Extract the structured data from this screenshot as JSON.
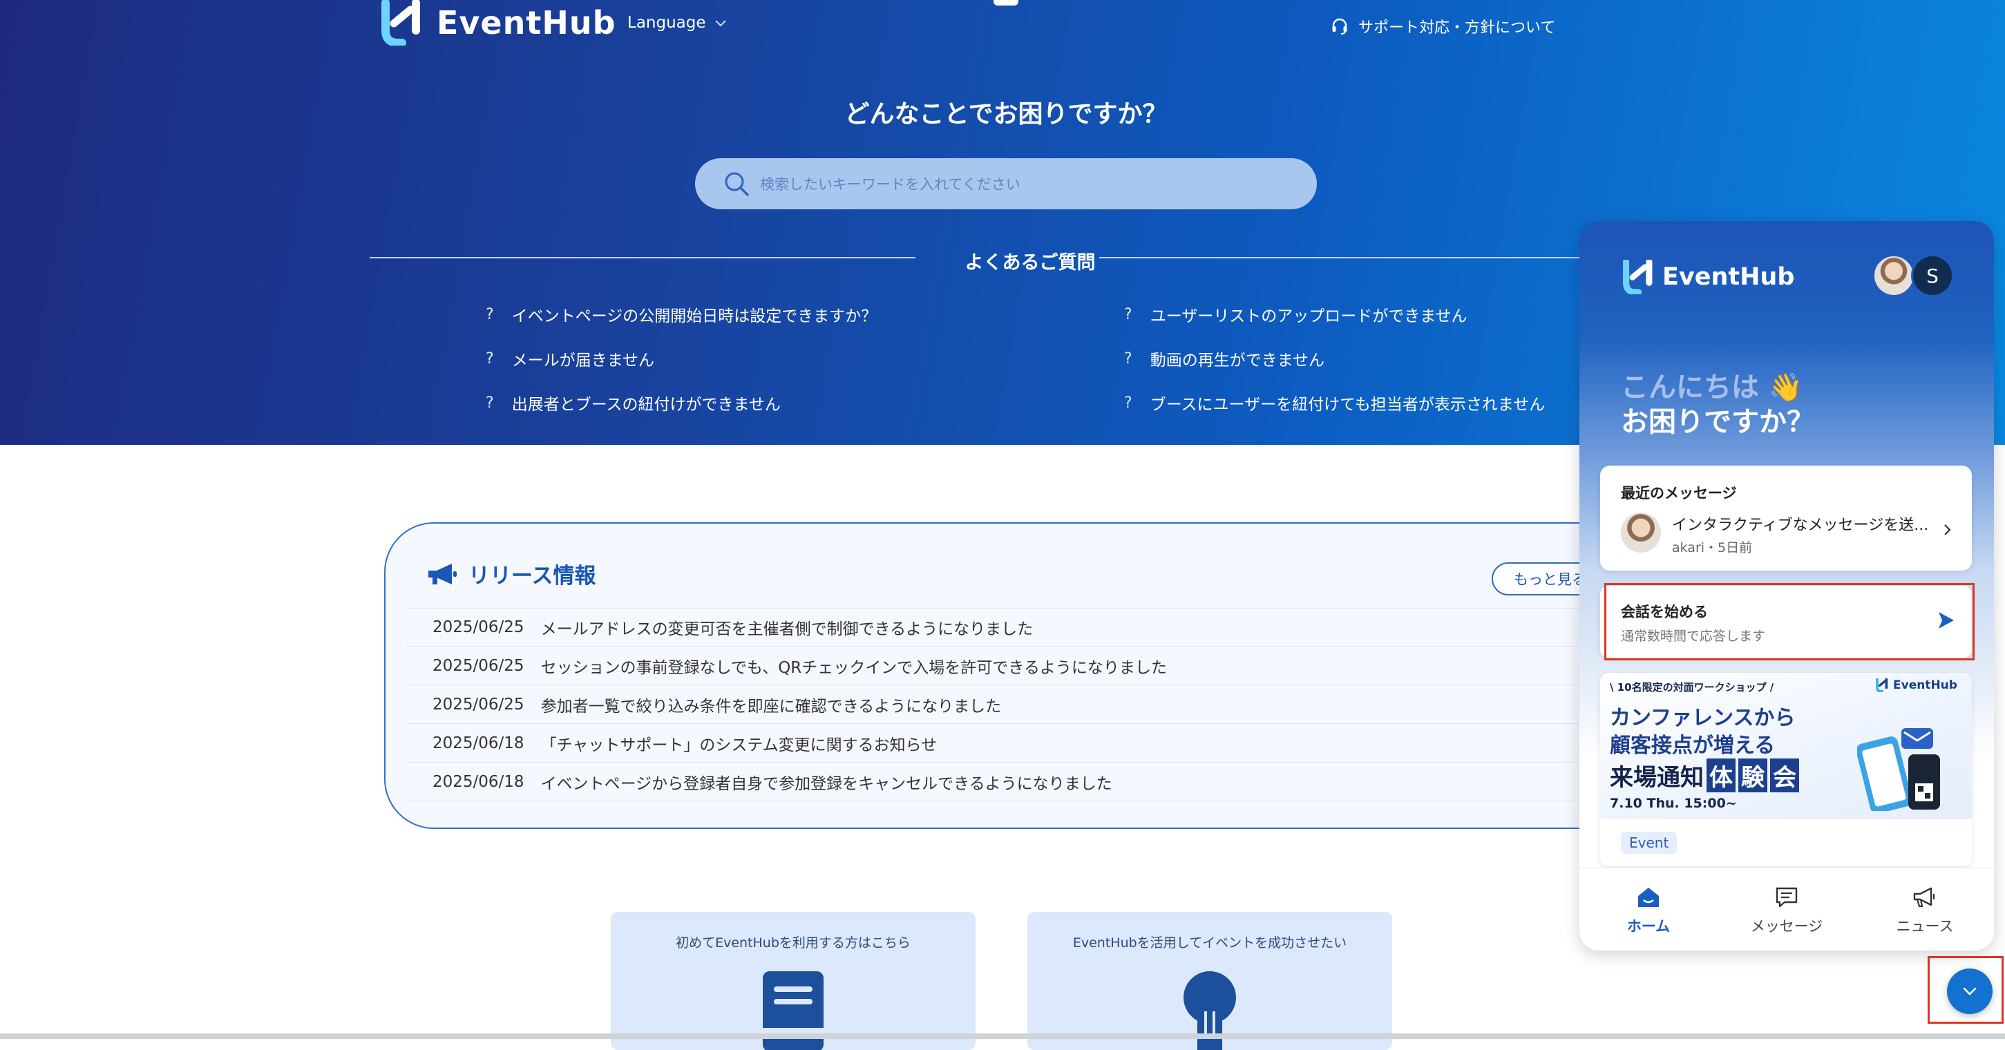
{
  "header": {
    "brand": "EventHub",
    "language_label": "Language",
    "support_link": "サポート対応・方針について"
  },
  "hero": {
    "title": "どんなことでお困りですか？",
    "search_placeholder": "検索したいキーワードを入れてください"
  },
  "faq": {
    "title": "よくあるご質問",
    "marker": "?",
    "left": [
      "イベントページの公開開始日時は設定できますか？",
      "メールが届きません",
      "出展者とブースの紐付けができません"
    ],
    "right": [
      "ユーザーリストのアップロードができません",
      "動画の再生ができません",
      "ブースにユーザーを紐付けても担当者が表示されません"
    ]
  },
  "release": {
    "title": "リリース情報",
    "more_label": "もっと見る",
    "items": [
      {
        "date": "2025/06/25",
        "text": "メールアドレスの変更可否を主催者側で制御できるようになりました"
      },
      {
        "date": "2025/06/25",
        "text": "セッションの事前登録なしでも、QRチェックインで入場を許可できるようになりました"
      },
      {
        "date": "2025/06/25",
        "text": "参加者一覧で絞り込み条件を即座に確認できるようになりました"
      },
      {
        "date": "2025/06/18",
        "text": "「チャットサポート」のシステム変更に関するお知らせ"
      },
      {
        "date": "2025/06/18",
        "text": "イベントページから登録者自身で参加登録をキャンセルできるようになりました"
      }
    ]
  },
  "cards": [
    {
      "title": "初めてEventHubを利用する方はこちら",
      "icon": "book-icon"
    },
    {
      "title": "EventHubを活用してイベントを成功させたい",
      "icon": "lightbulb-icon"
    }
  ],
  "widget": {
    "brand": "EventHub",
    "avatar_initial": "S",
    "greeting_line1": "こんにちは 👋",
    "greeting_line2": "お困りですか？",
    "recent": {
      "label": "最近のメッセージ",
      "message": "インタラクティブなメッセージを送...",
      "meta": "akari・5日前"
    },
    "conversation": {
      "title": "会話を始める",
      "subtitle": "通常数時間で応答します"
    },
    "banner": {
      "sub": "\\ 10名限定の対面ワークショップ /",
      "logo": "EventHub",
      "line1": "カンファレンスから",
      "line2": "顧客接点が増える",
      "line3_prefix": "来場通知",
      "line3_boxes": [
        "体",
        "験",
        "会"
      ],
      "date": "7.10 Thu. 15:00~",
      "tag": "Event"
    },
    "nav": [
      {
        "label": "ホーム",
        "icon": "home-icon",
        "active": true
      },
      {
        "label": "メッセージ",
        "icon": "message-icon",
        "active": false
      },
      {
        "label": "ニュース",
        "icon": "megaphone-icon",
        "active": false
      }
    ]
  },
  "colors": {
    "hero_start": "#1e2a80",
    "hero_end": "#0a88e0",
    "accent": "#1a57b4",
    "highlight": "#e0351f",
    "fab": "#1372cf"
  }
}
